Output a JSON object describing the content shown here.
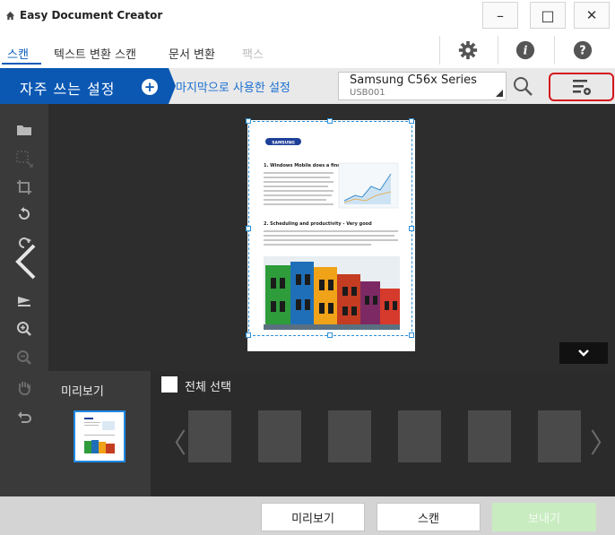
{
  "window": {
    "title": "Easy Document Creator",
    "minimize": "–",
    "maximize": "□",
    "close": "✕"
  },
  "tabs": [
    {
      "label": "스캔",
      "active": true
    },
    {
      "label": "텍스트 변환 스캔",
      "active": false
    },
    {
      "label": "문서 변환",
      "active": false
    },
    {
      "label": "팩스",
      "active": false,
      "disabled": true
    }
  ],
  "settings": {
    "favorites_label": "자주 쓰는 설정",
    "add_symbol": "+",
    "last_used": "마지막으로 사용한 설정"
  },
  "device": {
    "name": "Samsung C56x Series",
    "port": "USB001"
  },
  "document": {
    "logo": "SAMSUNG",
    "heading1": "1. Windows Mobile does a fine",
    "heading2": "2. Scheduling and productivity - Very good"
  },
  "preview": {
    "label": "미리보기",
    "select_all": "전체 선택",
    "prev_arrow": "〈",
    "next_arrow": "〉"
  },
  "bottom": {
    "preview_button": "미리보기",
    "scan_button": "스캔",
    "send_button": "보내기"
  },
  "colors": {
    "accent": "#0b58b3",
    "link": "#1a6fd1",
    "highlight_border": "#d4161c",
    "selection": "#2b8fd8",
    "send_disabled": "#c8ecc0"
  }
}
